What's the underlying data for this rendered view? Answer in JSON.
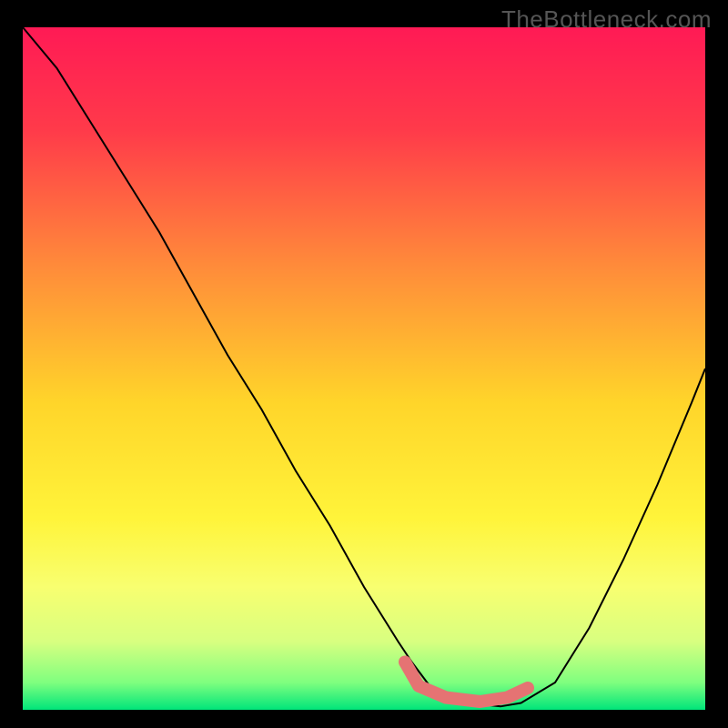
{
  "watermark": "TheBottleneck.com",
  "chart_data": {
    "type": "line",
    "title": "",
    "xlabel": "",
    "ylabel": "",
    "xlim": [
      0,
      100
    ],
    "ylim": [
      0,
      100
    ],
    "grid": false,
    "gradient_stops": [
      {
        "offset": 0,
        "color": "#ff1a55"
      },
      {
        "offset": 15,
        "color": "#ff3a4a"
      },
      {
        "offset": 35,
        "color": "#ff8b3a"
      },
      {
        "offset": 55,
        "color": "#ffd52a"
      },
      {
        "offset": 72,
        "color": "#fff43a"
      },
      {
        "offset": 82,
        "color": "#f8ff70"
      },
      {
        "offset": 90,
        "color": "#d8ff80"
      },
      {
        "offset": 96,
        "color": "#7fff7f"
      },
      {
        "offset": 100,
        "color": "#00e57a"
      }
    ],
    "series": [
      {
        "name": "bottleneck-curve",
        "stroke": "#000000",
        "stroke_width": 2,
        "x": [
          0,
          5,
          10,
          15,
          20,
          25,
          30,
          35,
          40,
          45,
          50,
          55,
          57,
          60,
          65,
          70,
          73,
          78,
          83,
          88,
          93,
          98,
          100
        ],
        "y": [
          100,
          94,
          86,
          78,
          70,
          61,
          52,
          44,
          35,
          27,
          18,
          10,
          7,
          3,
          1,
          0.5,
          1,
          4,
          12,
          22,
          33,
          45,
          50
        ]
      },
      {
        "name": "flat-zone-marker",
        "type": "polyline-marker",
        "stroke": "#e57373",
        "stroke_width": 14,
        "linecap": "round",
        "points_x": [
          56,
          58,
          62,
          67,
          71,
          74
        ],
        "points_y": [
          7.0,
          3.5,
          1.8,
          1.2,
          1.8,
          3.2
        ]
      }
    ]
  }
}
